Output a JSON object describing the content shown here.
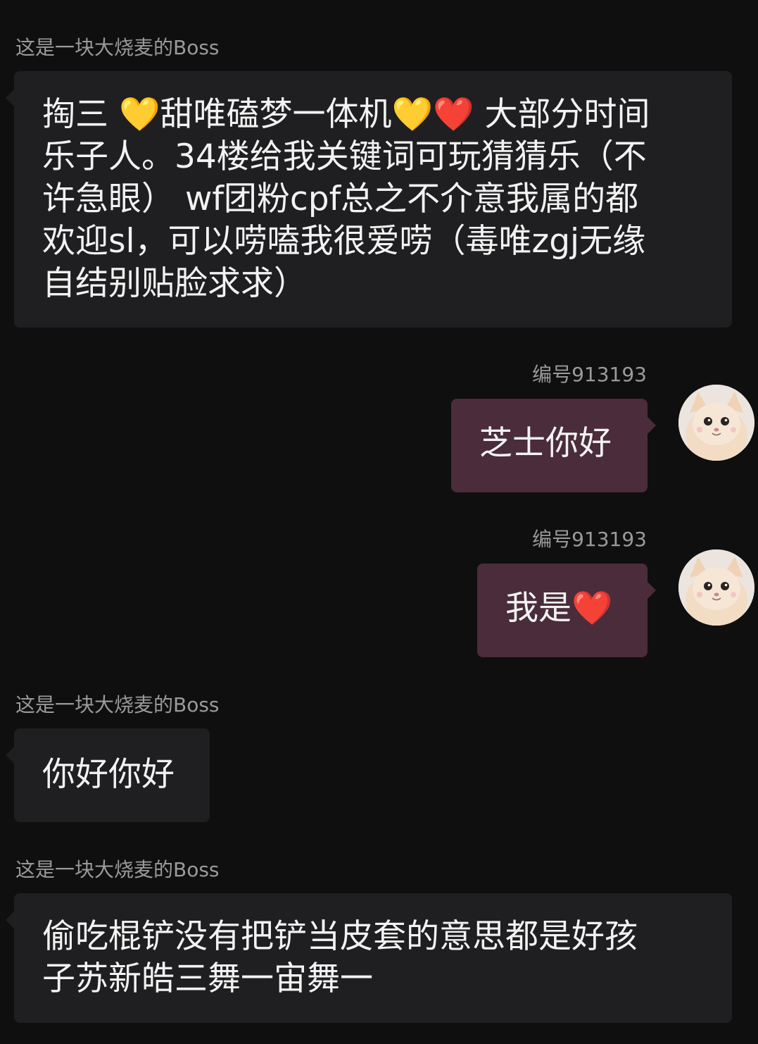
{
  "messages": [
    {
      "side": "left",
      "sender": "这是一块大烧麦的Boss",
      "lines": [
        "掏三 💛甜唯磕梦一体机💛❤️ 大部分时间",
        "乐子人。34楼给我关键词可玩猜猜乐（不",
        "许急眼） wf团粉cpf总之不介意我属的都",
        "欢迎sl，可以唠嗑我很爱唠（毒唯zgj无缘",
        "自结别贴脸求求）"
      ]
    },
    {
      "side": "right",
      "sender": "编号913193",
      "text": "芝士你好",
      "avatar_icon": "cat-avatar-icon"
    },
    {
      "side": "right",
      "sender": "编号913193",
      "text": "我是",
      "emoji": "❤️",
      "avatar_icon": "cat-avatar-icon"
    },
    {
      "side": "left",
      "sender": "这是一块大烧麦的Boss",
      "text": "你好你好"
    },
    {
      "side": "left",
      "sender": "这是一块大烧麦的Boss",
      "lines": [
        "偷吃棍铲没有把铲当皮套的意思都是好孩",
        "子苏新皓三舞一宙舞一"
      ]
    }
  ],
  "colors": {
    "background": "#0f0f10",
    "left_bubble": "#1f1f21",
    "right_bubble": "#4a2c3a",
    "sender_text": "#9a9a9c",
    "message_text": "#f2f2f2"
  }
}
